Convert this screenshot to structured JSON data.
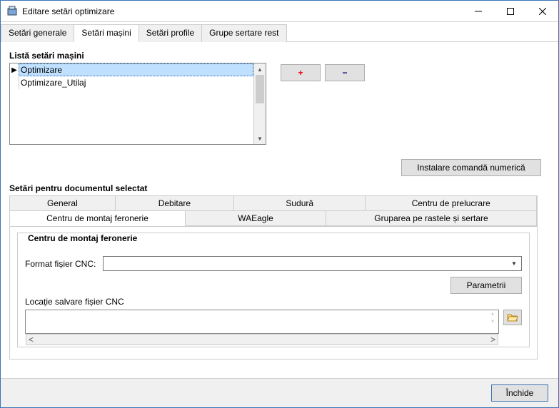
{
  "window": {
    "title": "Editare setări optimizare"
  },
  "tabs": {
    "t1": "Setări generale",
    "t2": "Setări mașini",
    "t3": "Setări profile",
    "t4": "Grupe sertare rest"
  },
  "list": {
    "label": "Listă setări mașini",
    "items": [
      "Optimizare",
      "Optimizare_Utilaj"
    ]
  },
  "buttons": {
    "install_nc": "Instalare comandă numerică",
    "parameters": "Parametrii",
    "close": "Închide"
  },
  "doc": {
    "label": "Setări pentru documentul selectat",
    "tabs1": {
      "a": "General",
      "b": "Debitare",
      "c": "Sudură",
      "d": "Centru de prelucrare"
    },
    "tabs2": {
      "a": "Centru de montaj feronerie",
      "b": "WAEagle",
      "c": "Gruparea pe rastele și sertare"
    }
  },
  "group": {
    "title": "Centru de montaj feronerie",
    "format_label": "Format fișier CNC:",
    "location_label": "Locație salvare fișier CNC"
  }
}
